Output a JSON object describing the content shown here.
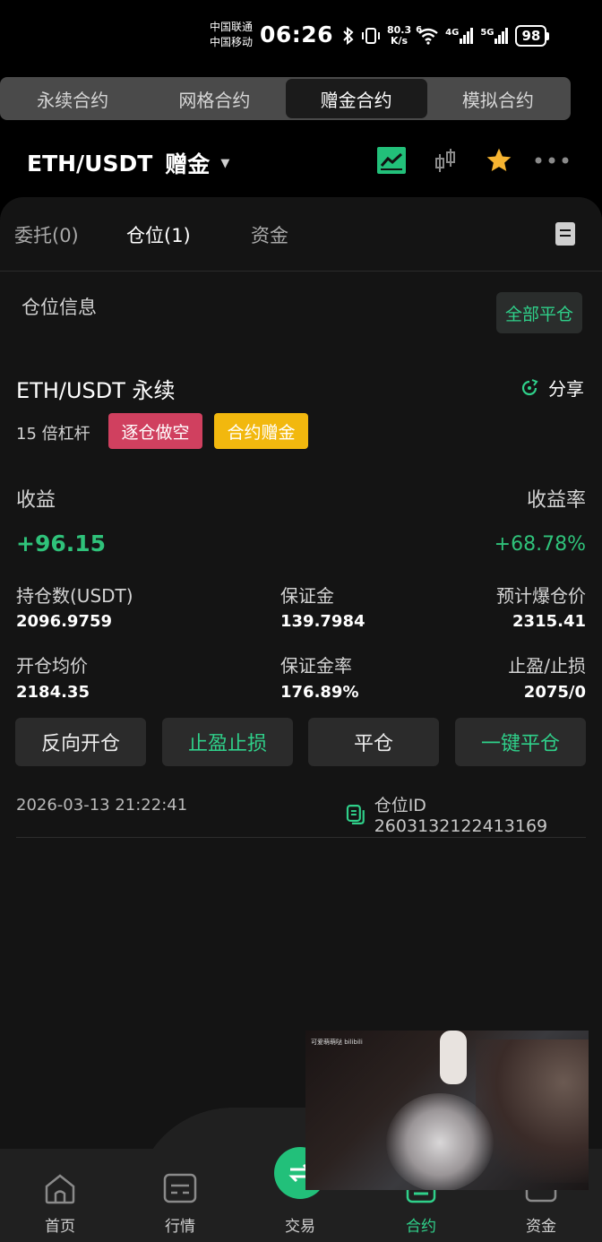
{
  "status_bar": {
    "carrier1": "中国联通",
    "carrier2": "中国移动",
    "time": "06:26",
    "net_speed": "80.3",
    "net_speed_unit": "K/s",
    "wifi_label": "6",
    "net1": "4G",
    "net2": "5G",
    "battery": "98"
  },
  "contract_tabs": [
    {
      "label": "永续合约",
      "active": false
    },
    {
      "label": "网格合约",
      "active": false
    },
    {
      "label": "赠金合约",
      "active": true
    },
    {
      "label": "模拟合约",
      "active": false
    }
  ],
  "header": {
    "pair": "ETH/USDT",
    "mode": "赠金",
    "accent": "#2fd08a",
    "star_color": "#f6b431"
  },
  "subtabs": {
    "orders": "委托(0)",
    "positions": "仓位(1)",
    "funds": "资金"
  },
  "position_section": {
    "title": "仓位信息",
    "close_all": "全部平仓"
  },
  "position": {
    "name": "ETH/USDT 永续",
    "share": "分享",
    "leverage": "15 倍杠杆",
    "side_badge": "逐仓做空",
    "bonus_badge": "合约赠金",
    "pnl_label": "收益",
    "pnl_rate_label": "收益率",
    "pnl": "+96.15",
    "pnl_rate": "+68.78%",
    "size_label": "持仓数(USDT)",
    "size": "2096.9759",
    "margin_label": "保证金",
    "margin": "139.7984",
    "liq_label": "预计爆仓价",
    "liq": "2315.41",
    "entry_label": "开仓均价",
    "entry": "2184.35",
    "margin_rate_label": "保证金率",
    "margin_rate": "176.89%",
    "tpsl_label": "止盈/止损",
    "tpsl": "2075/0",
    "timestamp": "2026-03-13 21:22:41",
    "position_id": "仓位ID 2603132122413169"
  },
  "actions": {
    "reverse": "反向开仓",
    "tpsl": "止盈止损",
    "close": "平仓",
    "one_click_close": "一键平仓"
  },
  "bottom_nav": {
    "home": "首页",
    "market": "行情",
    "trade": "交易",
    "contract": "合约",
    "assets": "资金"
  },
  "video_overlay": {
    "caption": "可爱萌萌哒 bilibili"
  }
}
